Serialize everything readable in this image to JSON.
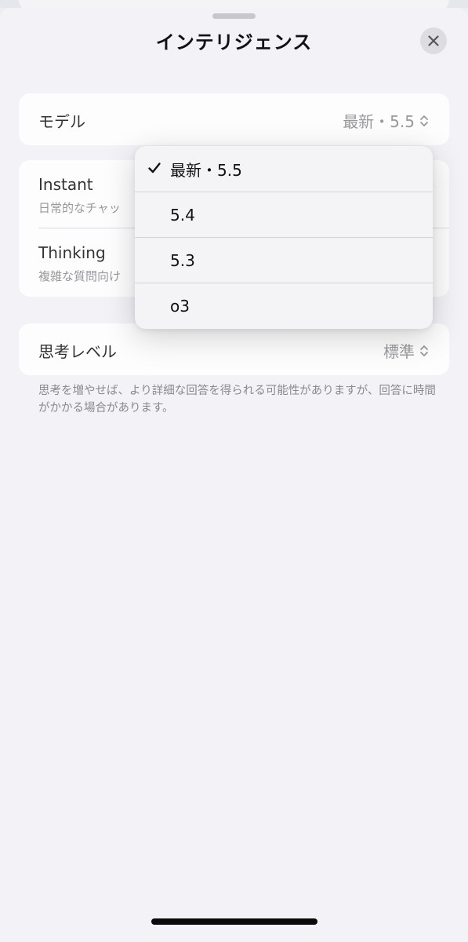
{
  "sheet": {
    "title": "インテリジェンス"
  },
  "model_row": {
    "label": "モデル",
    "value": "最新・5.5"
  },
  "modes": [
    {
      "label": "Instant",
      "subtitle": "日常的なチャッ"
    },
    {
      "label": "Thinking",
      "subtitle": "複雑な質問向け"
    }
  ],
  "thinking_level_row": {
    "label": "思考レベル",
    "value": "標準"
  },
  "note": "思考を増やせば、より詳細な回答を得られる可能性がありますが、回答に時間がかかる場合があります。",
  "model_menu": {
    "selected_index": 0,
    "items": [
      "最新・5.5",
      "5.4",
      "5.3",
      "o3"
    ]
  },
  "icons": {
    "close": "close-icon",
    "chevron": "chevron-up-down-icon",
    "check": "checkmark-icon"
  }
}
